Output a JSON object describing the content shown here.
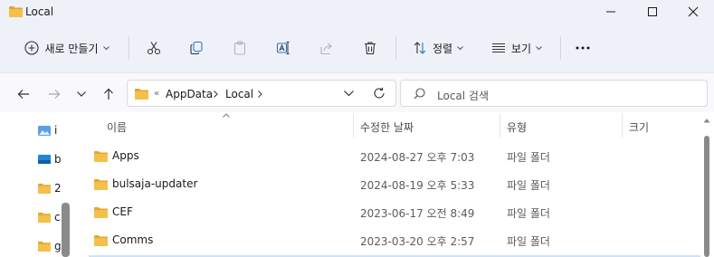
{
  "window": {
    "title": "Local",
    "controls": {
      "minimize": "minimize-icon",
      "maximize": "maximize-icon",
      "close": "close-icon"
    }
  },
  "toolbar": {
    "new_label": "새로 만들기",
    "sort_label": "정렬",
    "view_label": "보기",
    "icons": [
      "cut-icon",
      "copy-icon",
      "paste-icon",
      "rename-icon",
      "share-icon",
      "delete-icon",
      "more-icon"
    ]
  },
  "nav": {
    "breadcrumb_sep": "«",
    "breadcrumbs": [
      "AppData",
      "Local"
    ],
    "search_placeholder": "Local 검색"
  },
  "sidebar": {
    "items": [
      {
        "label": "i",
        "icon": "image-folder-icon"
      },
      {
        "label": "b",
        "icon": "desktop-folder-icon"
      },
      {
        "label": "2",
        "icon": "folder-icon"
      },
      {
        "label": "c",
        "icon": "folder-icon"
      },
      {
        "label": "g",
        "icon": "folder-icon"
      }
    ]
  },
  "columns": {
    "name": "이름",
    "modified": "수정한 날짜",
    "type": "유형",
    "size": "크기"
  },
  "files": [
    {
      "name": "Apps",
      "modified": "2024-08-27 오후 7:03",
      "type": "파일 폴더"
    },
    {
      "name": "bulsaja-updater",
      "modified": "2024-08-19 오후 5:33",
      "type": "파일 폴더"
    },
    {
      "name": "CEF",
      "modified": "2023-06-17 오전 8:49",
      "type": "파일 폴더"
    },
    {
      "name": "Comms",
      "modified": "2023-03-20 오후 2:57",
      "type": "파일 폴더"
    }
  ],
  "colors": {
    "folder": "#f3c04b",
    "folder_dark": "#e0a82e",
    "chrome_bg": "#eef1f8",
    "content_bg": "#ffffff"
  }
}
